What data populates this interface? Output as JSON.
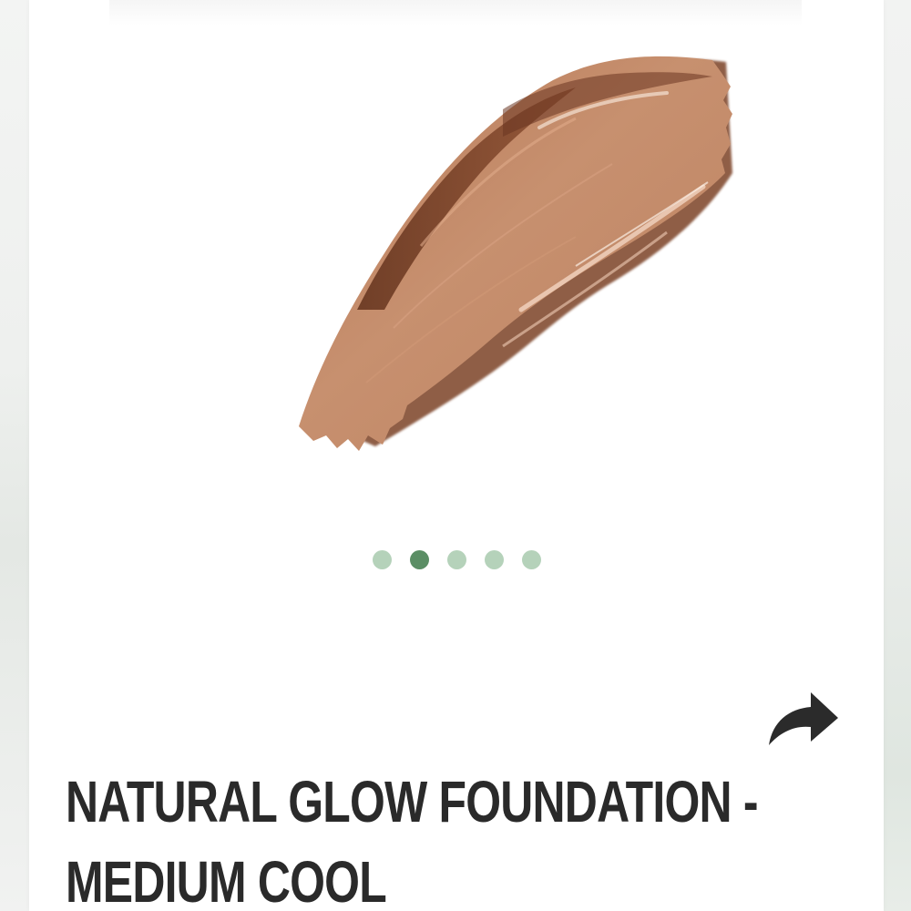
{
  "product": {
    "title_line1": "NATURAL GLOW FOUNDATION -",
    "title_line2": "MEDIUM COOL",
    "image_alt": "foundation-swatch"
  },
  "carousel": {
    "total": 5,
    "active_index": 1,
    "dot_color": "#b5d2ba",
    "active_dot_color": "#5b8e65"
  },
  "actions": {
    "share_icon": "share-arrow-icon"
  },
  "colors": {
    "swatch_base": "#c28868",
    "swatch_dark": "#6e3a22",
    "title_text": "#2a2a2a"
  }
}
